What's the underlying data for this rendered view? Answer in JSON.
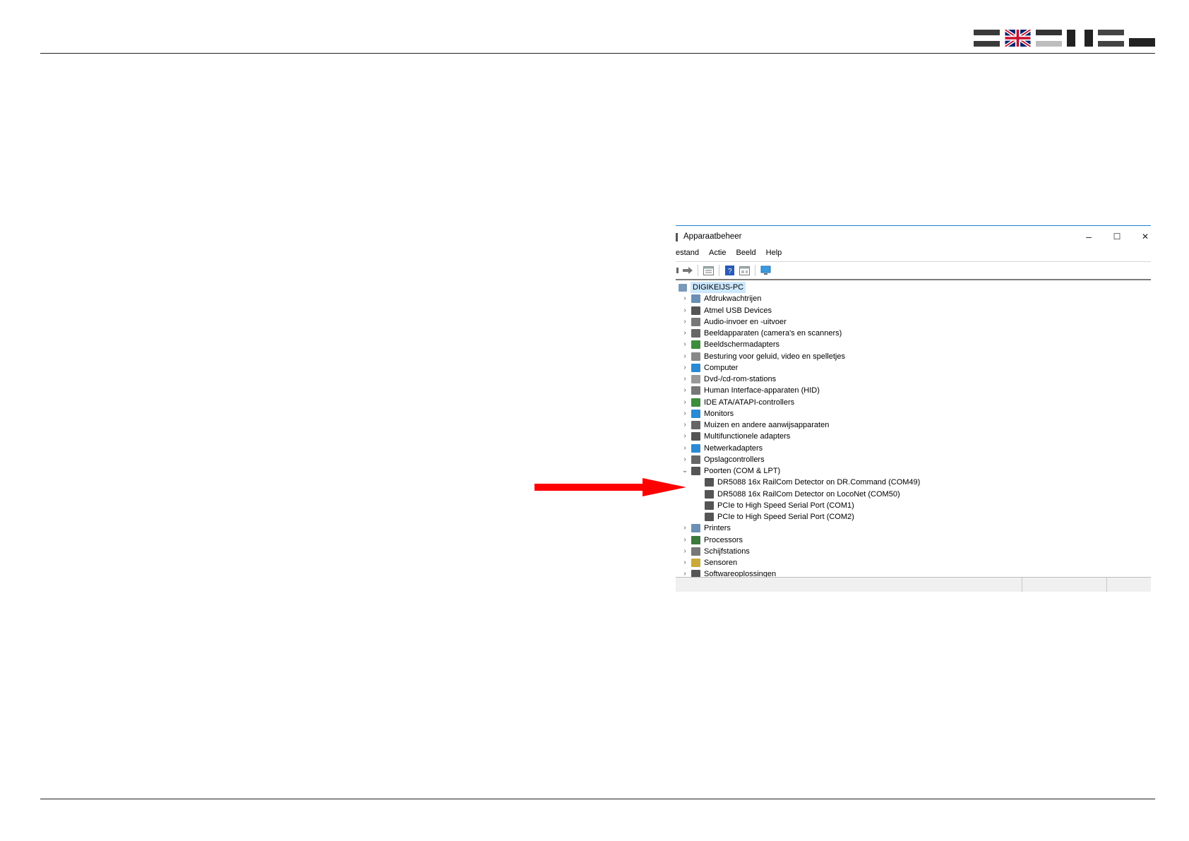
{
  "flags": [
    {
      "name": "flag-de",
      "bands": [
        "#3a3a3a",
        "#ffffff",
        "#3a3a3a"
      ]
    },
    {
      "name": "flag-uk"
    },
    {
      "name": "flag-nl",
      "bands": [
        "#333333",
        "#ffffff",
        "#bdbdbd"
      ]
    },
    {
      "name": "flag-it",
      "vbands": [
        "#222222",
        "#ffffff",
        "#222222"
      ]
    },
    {
      "name": "flag-fr",
      "bands": [
        "#444444",
        "#ffffff",
        "#444444"
      ]
    },
    {
      "name": "flag-pl",
      "bands": [
        "#ffffff",
        "#222222"
      ]
    }
  ],
  "window": {
    "title": "Apparaatbeheer",
    "controls": {
      "minimize": "–",
      "maximize": "☐",
      "close": "✕"
    },
    "menu": [
      "estand",
      "Actie",
      "Beeld",
      "Help"
    ],
    "tree": {
      "root": "DIGIKEIJS-PC",
      "items": [
        {
          "label": "Afdrukwachtrijen",
          "icon": "printer-queue-icon",
          "color": "#6b8fb5"
        },
        {
          "label": "Atmel USB Devices",
          "icon": "usb-icon",
          "color": "#555555"
        },
        {
          "label": "Audio-invoer en -uitvoer",
          "icon": "speaker-icon",
          "color": "#777777"
        },
        {
          "label": "Beeldapparaten (camera's en scanners)",
          "icon": "camera-icon",
          "color": "#666666"
        },
        {
          "label": "Beeldschermadapters",
          "icon": "display-adapter-icon",
          "color": "#3c8d3c"
        },
        {
          "label": "Besturing voor geluid, video en spelletjes",
          "icon": "sound-video-icon",
          "color": "#888888"
        },
        {
          "label": "Computer",
          "icon": "computer-icon",
          "color": "#2a8ad4"
        },
        {
          "label": "Dvd-/cd-rom-stations",
          "icon": "dvd-icon",
          "color": "#999999"
        },
        {
          "label": "Human Interface-apparaten (HID)",
          "icon": "hid-icon",
          "color": "#777777"
        },
        {
          "label": "IDE ATA/ATAPI-controllers",
          "icon": "ide-controller-icon",
          "color": "#3c8d3c"
        },
        {
          "label": "Monitors",
          "icon": "monitor-icon",
          "color": "#2a8ad4"
        },
        {
          "label": "Muizen en andere aanwijsapparaten",
          "icon": "mouse-icon",
          "color": "#666666"
        },
        {
          "label": "Multifunctionele adapters",
          "icon": "multifunction-icon",
          "color": "#555555"
        },
        {
          "label": "Netwerkadapters",
          "icon": "network-adapter-icon",
          "color": "#2a8ad4"
        },
        {
          "label": "Opslagcontrollers",
          "icon": "storage-controller-icon",
          "color": "#666666"
        },
        {
          "label": "Poorten (COM & LPT)",
          "icon": "port-icon",
          "color": "#555555",
          "expanded": true
        },
        {
          "label": "DR5088 16x RailCom Detector on DR.Command (COM49)",
          "icon": "port-icon",
          "color": "#555555",
          "child": true
        },
        {
          "label": "DR5088 16x RailCom Detector on LocoNet (COM50)",
          "icon": "port-icon",
          "color": "#555555",
          "child": true
        },
        {
          "label": "PCIe to High Speed Serial Port (COM1)",
          "icon": "port-icon",
          "color": "#555555",
          "child": true
        },
        {
          "label": "PCIe to High Speed Serial Port (COM2)",
          "icon": "port-icon",
          "color": "#555555",
          "child": true
        },
        {
          "label": "Printers",
          "icon": "printer-icon",
          "color": "#6b8fb5"
        },
        {
          "label": "Processors",
          "icon": "processor-icon",
          "color": "#3c7a3c"
        },
        {
          "label": "Schijfstations",
          "icon": "disk-drive-icon",
          "color": "#777777"
        },
        {
          "label": "Sensoren",
          "icon": "sensor-icon",
          "color": "#c9a93a"
        },
        {
          "label": "Softwareoplossingen",
          "icon": "software-icon",
          "color": "#555555"
        }
      ]
    }
  },
  "arrow_color": "#ff0000"
}
